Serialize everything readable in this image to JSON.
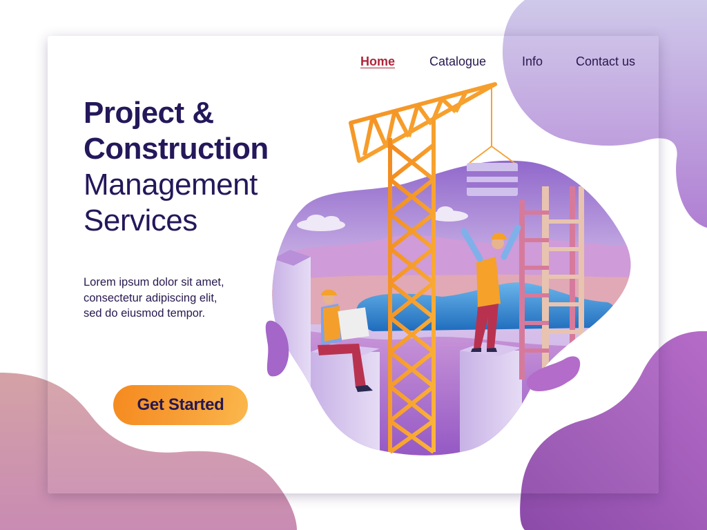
{
  "nav": {
    "items": [
      {
        "label": "Home",
        "active": true
      },
      {
        "label": "Catalogue",
        "active": false
      },
      {
        "label": "Info",
        "active": false
      },
      {
        "label": "Contact us",
        "active": false
      }
    ]
  },
  "hero": {
    "title_bold_line1": "Project &",
    "title_bold_line2": "Construction",
    "title_light_line1": "Management",
    "title_light_line2": "Services",
    "description": "Lorem ipsum dolor sit amet, consectetur adipiscing elit, sed do eiusmod tempor.",
    "cta_label": "Get Started"
  },
  "illustration": {
    "subject": "construction site with tower crane, two workers, ladders and building blocks",
    "icons": [
      "tower-crane-icon",
      "worker-sitting-icon",
      "worker-waving-icon",
      "ladder-icon",
      "cloud-icon",
      "hanging-load-icon"
    ]
  },
  "colors": {
    "text_primary": "#27184f",
    "nav_active": "#b0253a",
    "cta_orange": "#f7a23a",
    "purple_accent": "#9b5cc4",
    "pink_blob": "#c98fae"
  }
}
